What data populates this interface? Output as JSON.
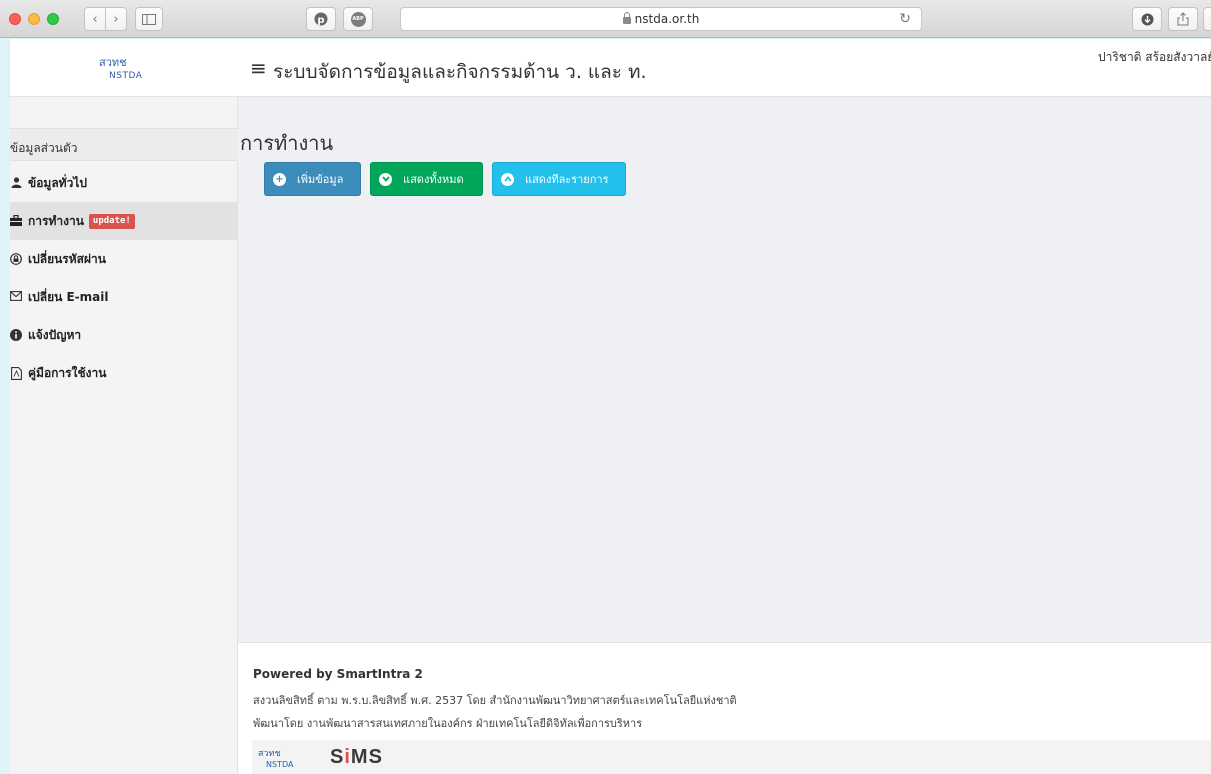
{
  "browser": {
    "url": "nstda.or.th",
    "icons": [
      "pinterest-icon",
      "adblock-icon",
      "download-icon",
      "share-icon"
    ],
    "adblock_label": "ABP"
  },
  "header": {
    "logo_text_top": "สวทช",
    "logo_text_bottom": "NSTDA",
    "menu_icon": "≡",
    "title": "ระบบจัดการข้อมูลและกิจกรรมด้าน ว. และ ท.",
    "user": "ปาริชาติ สร้อยสังวาลย์"
  },
  "sidebar": {
    "section_label": "ข้อมูลส่วนตัว",
    "items": [
      {
        "label": "ข้อมูลทั่วไป",
        "icon": "user-icon"
      },
      {
        "label": "การทำงาน",
        "icon": "briefcase-icon",
        "badge": "update!",
        "active": true
      },
      {
        "label": "เปลี่ยนรหัสผ่าน",
        "icon": "lock-icon"
      },
      {
        "label": "เปลี่ยน E-mail",
        "icon": "envelope-icon"
      },
      {
        "label": "แจ้งปัญหา",
        "icon": "info-icon"
      },
      {
        "label": "คู่มือการใช้งาน",
        "icon": "pdf-file-icon"
      }
    ]
  },
  "main": {
    "title": "การทำงาน",
    "buttons": {
      "add": "เพิ่มข้อมูล",
      "show_all": "แสดงทั้งหมด",
      "show_per_page": "แสดงทีละรายการ"
    }
  },
  "footer": {
    "powered": "Powered by SmartIntra 2",
    "copyright": "สงวนลิขสิทธิ์ ตาม พ.ร.บ.ลิขสิทธิ์ พ.ศ. 2537 โดย สำนักงานพัฒนาวิทยาศาสตร์และเทคโนโลยีแห่งชาติ",
    "developed": "พัฒนาโดย งานพัฒนาสารสนเทศภายในองค์กร ฝ่ายเทคโนโลยีดิจิทัลเพื่อการบริหาร",
    "logo_sims_s": "S",
    "logo_sims_i": "i",
    "logo_sims_rest": "MS"
  },
  "colors": {
    "primary": "#3c8dbc",
    "success": "#00a65a",
    "info": "#22c0ea",
    "badge": "#d9534f"
  }
}
